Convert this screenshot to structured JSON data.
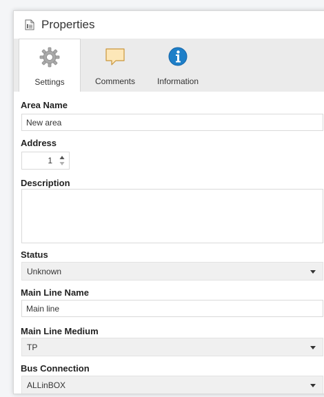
{
  "window": {
    "title": "Properties",
    "title_icon": "properties-document-icon",
    "close_glyph": "×"
  },
  "tabs": [
    {
      "label": "Settings",
      "icon": "gear-icon",
      "active": true
    },
    {
      "label": "Comments",
      "icon": "comment-icon",
      "active": false
    },
    {
      "label": "Information",
      "icon": "info-icon",
      "active": false
    }
  ],
  "form": {
    "area_name": {
      "label": "Area Name",
      "value": "New area"
    },
    "address": {
      "label": "Address",
      "value": "1"
    },
    "description": {
      "label": "Description",
      "value": ""
    },
    "status": {
      "label": "Status",
      "value": "Unknown"
    },
    "main_line_name": {
      "label": "Main Line Name",
      "value": "Main line"
    },
    "main_line_medium": {
      "label": "Main Line Medium",
      "value": "TP"
    },
    "bus_connection": {
      "label": "Bus Connection",
      "value": "ALLinBOX"
    }
  },
  "colors": {
    "accent_blue": "#1e7fc8",
    "tab_bar_bg": "#ebebeb",
    "select_bg": "#f0f0f0"
  }
}
